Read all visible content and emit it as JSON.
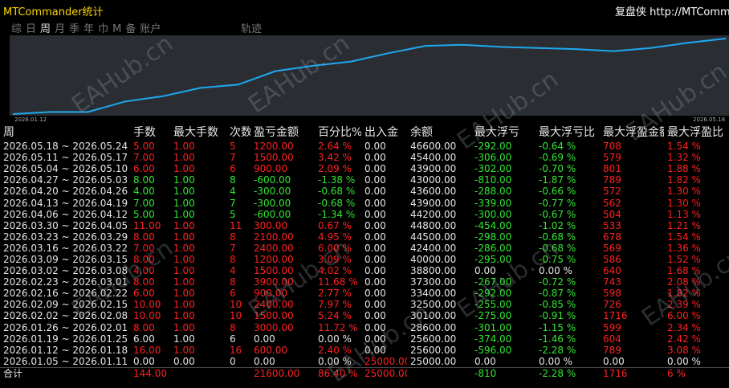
{
  "title": "MTCommander统计",
  "brand": "复盘侠 http://MTComm",
  "tabs": [
    {
      "label": "综",
      "active": false
    },
    {
      "label": "日",
      "active": false
    },
    {
      "label": "周",
      "active": true
    },
    {
      "label": "月",
      "active": false
    },
    {
      "label": "季",
      "active": false
    },
    {
      "label": "年",
      "active": false
    },
    {
      "label": "巾",
      "active": false
    },
    {
      "label": "M",
      "active": false
    },
    {
      "label": "备",
      "active": false
    },
    {
      "label": "账户",
      "active": false
    }
  ],
  "track_label": "轨迹",
  "chart": {
    "start_date": "2026.01.12",
    "end_date": "2026.05.18",
    "line_color": "#1ea8f0",
    "background": "#2a2e33",
    "points": [
      25000,
      25600,
      25600,
      28600,
      30100,
      32500,
      33400,
      37300,
      38800,
      40000,
      42400,
      44500,
      44800,
      44200,
      43900,
      43600,
      43000,
      43900,
      45400,
      46600
    ]
  },
  "watermark": "EAHub.cn",
  "headers": [
    "周",
    "手数",
    "最大手数",
    "次数",
    "盈亏金额",
    "百分比%",
    "出入金",
    "余额",
    "最大浮亏",
    "最大浮亏比",
    "最大浮盈金额",
    "最大浮盈比"
  ],
  "rows": [
    {
      "week": "2026.05.18 ~ 2026.05.24",
      "lots": "5.00",
      "max_lots": "1.00",
      "count": "5",
      "pnl": "1200.00",
      "pct": "2.64 %",
      "io": "0.00",
      "bal": "46600.00",
      "mfl": "-292.00",
      "mflp": "-0.64 %",
      "mfp": "708",
      "mfpp": "1.54 %",
      "sign": "r"
    },
    {
      "week": "2026.05.11 ~ 2026.05.17",
      "lots": "7.00",
      "max_lots": "1.00",
      "count": "7",
      "pnl": "1500.00",
      "pct": "3.42 %",
      "io": "0.00",
      "bal": "45400.00",
      "mfl": "-306.00",
      "mflp": "-0.69 %",
      "mfp": "579",
      "mfpp": "1.32 %",
      "sign": "r"
    },
    {
      "week": "2026.05.04 ~ 2026.05.10",
      "lots": "6.00",
      "max_lots": "1.00",
      "count": "6",
      "pnl": "900.00",
      "pct": "2.09 %",
      "io": "0.00",
      "bal": "43900.00",
      "mfl": "-302.00",
      "mflp": "-0.70 %",
      "mfp": "801",
      "mfpp": "1.88 %",
      "sign": "r"
    },
    {
      "week": "2026.04.27 ~ 2026.05.03",
      "lots": "8.00",
      "max_lots": "1.00",
      "count": "8",
      "pnl": "-600.00",
      "pct": "-1.38 %",
      "io": "0.00",
      "bal": "43000.00",
      "mfl": "-810.00",
      "mflp": "-1.87 %",
      "mfp": "789",
      "mfpp": "1.82 %",
      "sign": "g"
    },
    {
      "week": "2026.04.20 ~ 2026.04.26",
      "lots": "4.00",
      "max_lots": "1.00",
      "count": "4",
      "pnl": "-300.00",
      "pct": "-0.68 %",
      "io": "0.00",
      "bal": "43600.00",
      "mfl": "-288.00",
      "mflp": "-0.66 %",
      "mfp": "572",
      "mfpp": "1.30 %",
      "sign": "g"
    },
    {
      "week": "2026.04.13 ~ 2026.04.19",
      "lots": "7.00",
      "max_lots": "1.00",
      "count": "7",
      "pnl": "-300.00",
      "pct": "-0.68 %",
      "io": "0.00",
      "bal": "43900.00",
      "mfl": "-339.00",
      "mflp": "-0.77 %",
      "mfp": "562",
      "mfpp": "1.30 %",
      "sign": "g"
    },
    {
      "week": "2026.04.06 ~ 2026.04.12",
      "lots": "5.00",
      "max_lots": "1.00",
      "count": "5",
      "pnl": "-600.00",
      "pct": "-1.34 %",
      "io": "0.00",
      "bal": "44200.00",
      "mfl": "-300.00",
      "mflp": "-0.67 %",
      "mfp": "504",
      "mfpp": "1.13 %",
      "sign": "g"
    },
    {
      "week": "2026.03.30 ~ 2026.04.05",
      "lots": "11.00",
      "max_lots": "1.00",
      "count": "11",
      "pnl": "300.00",
      "pct": "0.67 %",
      "io": "0.00",
      "bal": "44800.00",
      "mfl": "-454.00",
      "mflp": "-1.02 %",
      "mfp": "533",
      "mfpp": "1.21 %",
      "sign": "r"
    },
    {
      "week": "2026.03.23 ~ 2026.03.29",
      "lots": "8.00",
      "max_lots": "1.00",
      "count": "8",
      "pnl": "2100.00",
      "pct": "4.95 %",
      "io": "0.00",
      "bal": "44500.00",
      "mfl": "-298.00",
      "mflp": "-0.68 %",
      "mfp": "678",
      "mfpp": "1.54 %",
      "sign": "r"
    },
    {
      "week": "2026.03.16 ~ 2026.03.22",
      "lots": "7.00",
      "max_lots": "1.00",
      "count": "7",
      "pnl": "2400.00",
      "pct": "6.00 %",
      "io": "0.00",
      "bal": "42400.00",
      "mfl": "-286.00",
      "mflp": "-0.68 %",
      "mfp": "569",
      "mfpp": "1.36 %",
      "sign": "r"
    },
    {
      "week": "2026.03.09 ~ 2026.03.15",
      "lots": "8.00",
      "max_lots": "1.00",
      "count": "8",
      "pnl": "1200.00",
      "pct": "3.09 %",
      "io": "0.00",
      "bal": "40000.00",
      "mfl": "-295.00",
      "mflp": "-0.75 %",
      "mfp": "586",
      "mfpp": "1.52 %",
      "sign": "r"
    },
    {
      "week": "2026.03.02 ~ 2026.03.08",
      "lots": "4.00",
      "max_lots": "1.00",
      "count": "4",
      "pnl": "1500.00",
      "pct": "4.02 %",
      "io": "0.00",
      "bal": "38800.00",
      "mfl": "0.00",
      "mflp": "0.00 %",
      "mfp": "640",
      "mfpp": "1.68 %",
      "sign": "r",
      "mfl_w": true
    },
    {
      "week": "2026.02.23 ~ 2026.03.01",
      "lots": "8.00",
      "max_lots": "1.00",
      "count": "8",
      "pnl": "3900.00",
      "pct": "11.68 %",
      "io": "0.00",
      "bal": "37300.00",
      "mfl": "-267.00",
      "mflp": "-0.72 %",
      "mfp": "743",
      "mfpp": "2.08 %",
      "sign": "r"
    },
    {
      "week": "2026.02.16 ~ 2026.02.22",
      "lots": "6.00",
      "max_lots": "1.00",
      "count": "6",
      "pnl": "900.00",
      "pct": "2.77 %",
      "io": "0.00",
      "bal": "33400.00",
      "mfl": "-292.00",
      "mflp": "-0.87 %",
      "mfp": "598",
      "mfpp": "1.82 %",
      "sign": "r"
    },
    {
      "week": "2026.02.09 ~ 2026.02.15",
      "lots": "10.00",
      "max_lots": "1.00",
      "count": "10",
      "pnl": "2400.00",
      "pct": "7.97 %",
      "io": "0.00",
      "bal": "32500.00",
      "mfl": "-255.00",
      "mflp": "-0.85 %",
      "mfp": "726",
      "mfpp": "2.39 %",
      "sign": "r"
    },
    {
      "week": "2026.02.02 ~ 2026.02.08",
      "lots": "10.00",
      "max_lots": "1.00",
      "count": "10",
      "pnl": "1500.00",
      "pct": "5.24 %",
      "io": "0.00",
      "bal": "30100.00",
      "mfl": "-275.00",
      "mflp": "-0.91 %",
      "mfp": "1716",
      "mfpp": "6.00 %",
      "sign": "r"
    },
    {
      "week": "2026.01.26 ~ 2026.02.01",
      "lots": "8.00",
      "max_lots": "1.00",
      "count": "8",
      "pnl": "3000.00",
      "pct": "11.72 %",
      "io": "0.00",
      "bal": "28600.00",
      "mfl": "-301.00",
      "mflp": "-1.15 %",
      "mfp": "599",
      "mfpp": "2.34 %",
      "sign": "r"
    },
    {
      "week": "2026.01.19 ~ 2026.01.25",
      "lots": "6.00",
      "max_lots": "1.00",
      "count": "6",
      "pnl": "0.00",
      "pct": "0.00 %",
      "io": "0.00",
      "bal": "25600.00",
      "mfl": "-374.00",
      "mflp": "-1.46 %",
      "mfp": "604",
      "mfpp": "2.42 %",
      "sign": "w"
    },
    {
      "week": "2026.01.12 ~ 2026.01.18",
      "lots": "16.00",
      "max_lots": "1.00",
      "count": "16",
      "pnl": "600.00",
      "pct": "2.40 %",
      "io": "0.00",
      "bal": "25600.00",
      "mfl": "-596.00",
      "mflp": "-2.28 %",
      "mfp": "789",
      "mfpp": "3.08 %",
      "sign": "r"
    },
    {
      "week": "2026.01.05 ~ 2026.01.11",
      "lots": "0.00",
      "max_lots": "0.00",
      "count": "0",
      "pnl": "0.00",
      "pct": "0.00 %",
      "io": "25000.00",
      "bal": "25000.00",
      "mfl": "0.00",
      "mflp": "0.00 %",
      "mfp": "0.00",
      "mfpp": "0.00 %",
      "sign": "w",
      "io_r": true
    }
  ],
  "total": {
    "label": "合计",
    "lots": "144.00",
    "pnl": "21600.00",
    "pct": "86.40 %",
    "io": "25000.00",
    "mfl": "-810",
    "mflp": "-2.28 %",
    "mfp": "1716",
    "mfpp": "6 %"
  }
}
